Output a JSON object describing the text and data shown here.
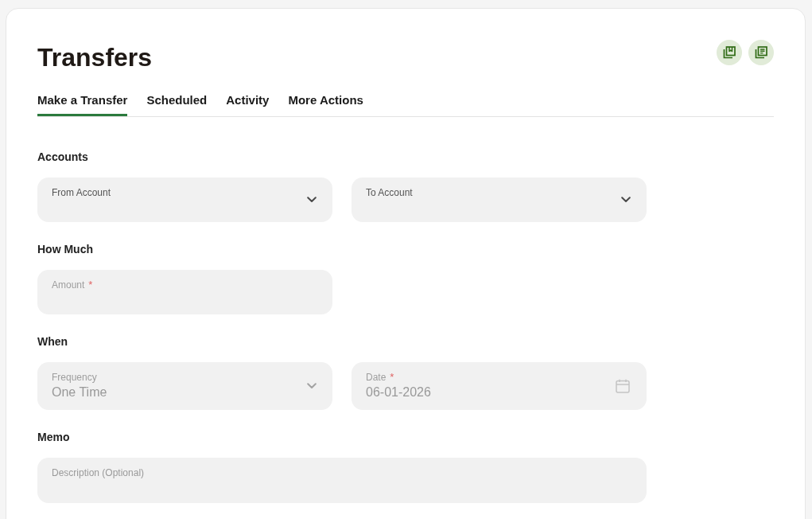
{
  "page": {
    "title": "Transfers"
  },
  "tabs": [
    {
      "label": "Make a Transfer",
      "selected": true
    },
    {
      "label": "Scheduled",
      "selected": false
    },
    {
      "label": "Activity",
      "selected": false
    },
    {
      "label": "More Actions",
      "selected": false
    }
  ],
  "sections": [
    {
      "heading": "Accounts",
      "fields": [
        {
          "kind": "select",
          "label": "From Account",
          "disabled": false
        },
        {
          "kind": "select",
          "label": "To Account",
          "disabled": false
        }
      ]
    },
    {
      "heading": "How Much",
      "fields": [
        {
          "kind": "text",
          "label": "Amount",
          "required_mark": "*",
          "disabled": true
        }
      ]
    },
    {
      "heading": "When",
      "fields": [
        {
          "kind": "select",
          "label": "Frequency",
          "value": "One Time",
          "disabled": true
        },
        {
          "kind": "date",
          "label": "Date",
          "required_mark": "*",
          "value": "06-01-2026",
          "disabled": true
        }
      ]
    },
    {
      "heading": "Memo",
      "fields": [
        {
          "kind": "textarea",
          "placeholder": "Description (Optional)",
          "disabled": true
        }
      ]
    }
  ]
}
